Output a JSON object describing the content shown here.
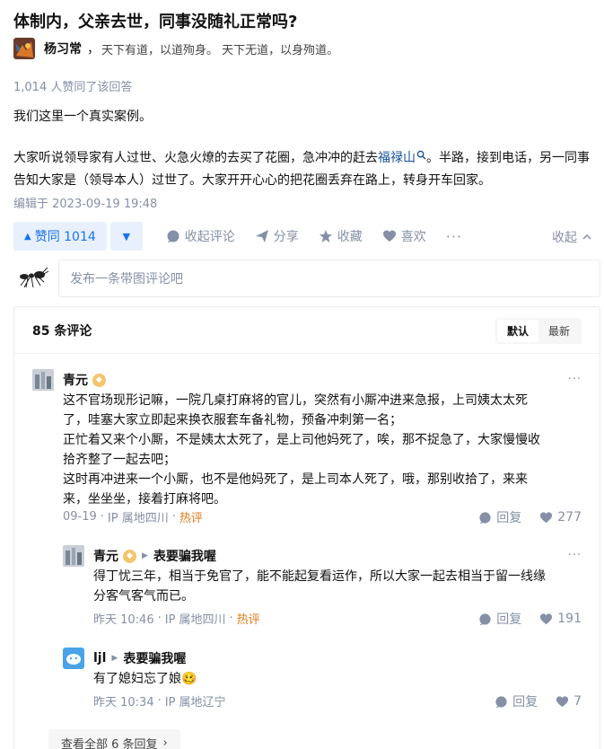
{
  "question": {
    "title": "体制内，父亲去世，同事没随礼正常吗?"
  },
  "author": {
    "name": "杨习常",
    "separator": "，",
    "bio": "天下有道，以道殉身。 天下无道，以身殉道。"
  },
  "answer": {
    "votes_text": "1,014 人赞同了该回答",
    "para1": "我们这里一个真实案例。",
    "para2_before": "大家听说领导家有人过世、火急火燎的去买了花圈，急冲冲的赶去",
    "para2_link": "福禄山",
    "para2_after": "。半路，接到电话，另一同事告知大家是（领导本人）过世了。大家开开心心的把花圈丢弃在路上，转身开车回家。",
    "edited": "编辑于 2023-09-19 19:48"
  },
  "actions": {
    "upvote_label": "赞同 1014",
    "upvote_icon": "▲",
    "downvote_icon": "▼",
    "comment_label": "收起评论",
    "share_label": "分享",
    "favorite_label": "收藏",
    "like_label": "喜欢",
    "more_label": "···",
    "collapse_label": "收起"
  },
  "compose": {
    "placeholder": "发布一条带图评论吧"
  },
  "comments_panel": {
    "count_label": "85 条评论",
    "sort_default": "默认",
    "sort_latest": "最新",
    "view_all": "查看全部 6 条回复",
    "view_all_arrow": "›"
  },
  "comments": [
    {
      "name": "青元",
      "lines": [
        "这不官场现形记嘛，一院几桌打麻将的官儿，突然有小厮冲进来急报，上司姨太太死",
        "了，哇塞大家立即起来换衣服套车备礼物，预备冲刺第一名；",
        "正忙着又来个小厮，不是姨太太死了，是上司他妈死了，唉，那不捉急了，大家慢慢收",
        "拾齐整了一起去吧；",
        "这时再冲进来一个小厮，也不是他妈死了，是上司本人死了，哦，那别收拾了，来来",
        "来，坐坐坐，接着打麻将吧。"
      ],
      "date": "09-19",
      "ip": "IP 属地四川",
      "hot": "热评",
      "reply_label": "回复",
      "likes": "277"
    },
    {
      "name": "青元",
      "reply_to": "表要骗我喔",
      "lines": [
        "得丁忧三年，相当于免官了，能不能起复看运作，所以大家一起去相当于留一线缘",
        "分客气客气而已。"
      ],
      "date": "昨天 10:46",
      "ip": "IP 属地四川",
      "hot": "热评",
      "reply_label": "回复",
      "likes": "191"
    },
    {
      "name": "ljl",
      "reply_to": "表要骗我喔",
      "lines": [
        "有了媳妇忘了娘🥴"
      ],
      "date": "昨天 10:34",
      "ip": "IP 属地辽宁",
      "reply_label": "回复",
      "likes": "7"
    }
  ],
  "colors": {
    "accent": "#1772f6",
    "accent_bg": "#e8f0fd",
    "muted": "#8590a6",
    "hot": "#e07a16"
  }
}
